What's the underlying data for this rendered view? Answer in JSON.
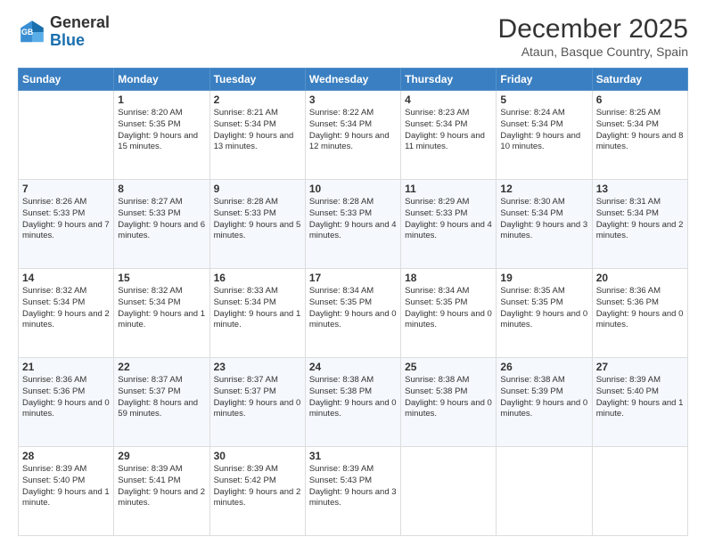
{
  "header": {
    "logo_general": "General",
    "logo_blue": "Blue",
    "month_title": "December 2025",
    "location": "Ataun, Basque Country, Spain"
  },
  "weekdays": [
    "Sunday",
    "Monday",
    "Tuesday",
    "Wednesday",
    "Thursday",
    "Friday",
    "Saturday"
  ],
  "weeks": [
    [
      {
        "num": "",
        "sunrise": "",
        "sunset": "",
        "daylight": "",
        "empty": true
      },
      {
        "num": "1",
        "sunrise": "Sunrise: 8:20 AM",
        "sunset": "Sunset: 5:35 PM",
        "daylight": "Daylight: 9 hours and 15 minutes.",
        "empty": false
      },
      {
        "num": "2",
        "sunrise": "Sunrise: 8:21 AM",
        "sunset": "Sunset: 5:34 PM",
        "daylight": "Daylight: 9 hours and 13 minutes.",
        "empty": false
      },
      {
        "num": "3",
        "sunrise": "Sunrise: 8:22 AM",
        "sunset": "Sunset: 5:34 PM",
        "daylight": "Daylight: 9 hours and 12 minutes.",
        "empty": false
      },
      {
        "num": "4",
        "sunrise": "Sunrise: 8:23 AM",
        "sunset": "Sunset: 5:34 PM",
        "daylight": "Daylight: 9 hours and 11 minutes.",
        "empty": false
      },
      {
        "num": "5",
        "sunrise": "Sunrise: 8:24 AM",
        "sunset": "Sunset: 5:34 PM",
        "daylight": "Daylight: 9 hours and 10 minutes.",
        "empty": false
      },
      {
        "num": "6",
        "sunrise": "Sunrise: 8:25 AM",
        "sunset": "Sunset: 5:34 PM",
        "daylight": "Daylight: 9 hours and 8 minutes.",
        "empty": false
      }
    ],
    [
      {
        "num": "7",
        "sunrise": "Sunrise: 8:26 AM",
        "sunset": "Sunset: 5:33 PM",
        "daylight": "Daylight: 9 hours and 7 minutes.",
        "empty": false
      },
      {
        "num": "8",
        "sunrise": "Sunrise: 8:27 AM",
        "sunset": "Sunset: 5:33 PM",
        "daylight": "Daylight: 9 hours and 6 minutes.",
        "empty": false
      },
      {
        "num": "9",
        "sunrise": "Sunrise: 8:28 AM",
        "sunset": "Sunset: 5:33 PM",
        "daylight": "Daylight: 9 hours and 5 minutes.",
        "empty": false
      },
      {
        "num": "10",
        "sunrise": "Sunrise: 8:28 AM",
        "sunset": "Sunset: 5:33 PM",
        "daylight": "Daylight: 9 hours and 4 minutes.",
        "empty": false
      },
      {
        "num": "11",
        "sunrise": "Sunrise: 8:29 AM",
        "sunset": "Sunset: 5:33 PM",
        "daylight": "Daylight: 9 hours and 4 minutes.",
        "empty": false
      },
      {
        "num": "12",
        "sunrise": "Sunrise: 8:30 AM",
        "sunset": "Sunset: 5:34 PM",
        "daylight": "Daylight: 9 hours and 3 minutes.",
        "empty": false
      },
      {
        "num": "13",
        "sunrise": "Sunrise: 8:31 AM",
        "sunset": "Sunset: 5:34 PM",
        "daylight": "Daylight: 9 hours and 2 minutes.",
        "empty": false
      }
    ],
    [
      {
        "num": "14",
        "sunrise": "Sunrise: 8:32 AM",
        "sunset": "Sunset: 5:34 PM",
        "daylight": "Daylight: 9 hours and 2 minutes.",
        "empty": false
      },
      {
        "num": "15",
        "sunrise": "Sunrise: 8:32 AM",
        "sunset": "Sunset: 5:34 PM",
        "daylight": "Daylight: 9 hours and 1 minute.",
        "empty": false
      },
      {
        "num": "16",
        "sunrise": "Sunrise: 8:33 AM",
        "sunset": "Sunset: 5:34 PM",
        "daylight": "Daylight: 9 hours and 1 minute.",
        "empty": false
      },
      {
        "num": "17",
        "sunrise": "Sunrise: 8:34 AM",
        "sunset": "Sunset: 5:35 PM",
        "daylight": "Daylight: 9 hours and 0 minutes.",
        "empty": false
      },
      {
        "num": "18",
        "sunrise": "Sunrise: 8:34 AM",
        "sunset": "Sunset: 5:35 PM",
        "daylight": "Daylight: 9 hours and 0 minutes.",
        "empty": false
      },
      {
        "num": "19",
        "sunrise": "Sunrise: 8:35 AM",
        "sunset": "Sunset: 5:35 PM",
        "daylight": "Daylight: 9 hours and 0 minutes.",
        "empty": false
      },
      {
        "num": "20",
        "sunrise": "Sunrise: 8:36 AM",
        "sunset": "Sunset: 5:36 PM",
        "daylight": "Daylight: 9 hours and 0 minutes.",
        "empty": false
      }
    ],
    [
      {
        "num": "21",
        "sunrise": "Sunrise: 8:36 AM",
        "sunset": "Sunset: 5:36 PM",
        "daylight": "Daylight: 9 hours and 0 minutes.",
        "empty": false
      },
      {
        "num": "22",
        "sunrise": "Sunrise: 8:37 AM",
        "sunset": "Sunset: 5:37 PM",
        "daylight": "Daylight: 8 hours and 59 minutes.",
        "empty": false
      },
      {
        "num": "23",
        "sunrise": "Sunrise: 8:37 AM",
        "sunset": "Sunset: 5:37 PM",
        "daylight": "Daylight: 9 hours and 0 minutes.",
        "empty": false
      },
      {
        "num": "24",
        "sunrise": "Sunrise: 8:38 AM",
        "sunset": "Sunset: 5:38 PM",
        "daylight": "Daylight: 9 hours and 0 minutes.",
        "empty": false
      },
      {
        "num": "25",
        "sunrise": "Sunrise: 8:38 AM",
        "sunset": "Sunset: 5:38 PM",
        "daylight": "Daylight: 9 hours and 0 minutes.",
        "empty": false
      },
      {
        "num": "26",
        "sunrise": "Sunrise: 8:38 AM",
        "sunset": "Sunset: 5:39 PM",
        "daylight": "Daylight: 9 hours and 0 minutes.",
        "empty": false
      },
      {
        "num": "27",
        "sunrise": "Sunrise: 8:39 AM",
        "sunset": "Sunset: 5:40 PM",
        "daylight": "Daylight: 9 hours and 1 minute.",
        "empty": false
      }
    ],
    [
      {
        "num": "28",
        "sunrise": "Sunrise: 8:39 AM",
        "sunset": "Sunset: 5:40 PM",
        "daylight": "Daylight: 9 hours and 1 minute.",
        "empty": false
      },
      {
        "num": "29",
        "sunrise": "Sunrise: 8:39 AM",
        "sunset": "Sunset: 5:41 PM",
        "daylight": "Daylight: 9 hours and 2 minutes.",
        "empty": false
      },
      {
        "num": "30",
        "sunrise": "Sunrise: 8:39 AM",
        "sunset": "Sunset: 5:42 PM",
        "daylight": "Daylight: 9 hours and 2 minutes.",
        "empty": false
      },
      {
        "num": "31",
        "sunrise": "Sunrise: 8:39 AM",
        "sunset": "Sunset: 5:43 PM",
        "daylight": "Daylight: 9 hours and 3 minutes.",
        "empty": false
      },
      {
        "num": "",
        "sunrise": "",
        "sunset": "",
        "daylight": "",
        "empty": true
      },
      {
        "num": "",
        "sunrise": "",
        "sunset": "",
        "daylight": "",
        "empty": true
      },
      {
        "num": "",
        "sunrise": "",
        "sunset": "",
        "daylight": "",
        "empty": true
      }
    ]
  ]
}
